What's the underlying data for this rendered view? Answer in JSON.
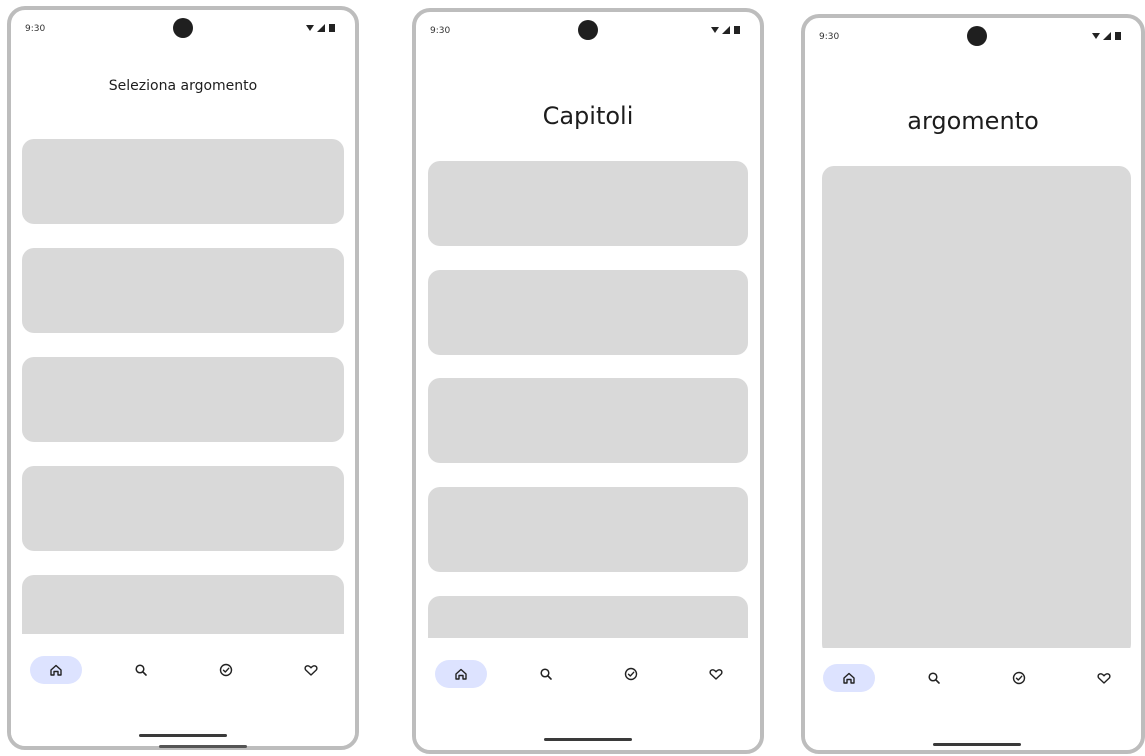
{
  "screens": [
    {
      "status_time": "9:30",
      "title": "Seleziona argomento",
      "nav": [
        {
          "icon": "home-icon",
          "active": true
        },
        {
          "icon": "search-icon",
          "active": false
        },
        {
          "icon": "check-circle-icon",
          "active": false
        },
        {
          "icon": "heart-icon",
          "active": false
        }
      ]
    },
    {
      "status_time": "9:30",
      "title": "Capitoli",
      "nav": [
        {
          "icon": "home-icon",
          "active": true
        },
        {
          "icon": "search-icon",
          "active": false
        },
        {
          "icon": "check-circle-icon",
          "active": false
        },
        {
          "icon": "heart-icon",
          "active": false
        }
      ]
    },
    {
      "status_time": "9:30",
      "title": "argomento",
      "nav": [
        {
          "icon": "home-icon",
          "active": true
        },
        {
          "icon": "search-icon",
          "active": false
        },
        {
          "icon": "check-circle-icon",
          "active": false
        },
        {
          "icon": "heart-icon",
          "active": false
        }
      ]
    }
  ],
  "colors": {
    "card": "#d9d9d9",
    "active_nav": "#dde3ff",
    "frame": "#bdbdbd"
  }
}
